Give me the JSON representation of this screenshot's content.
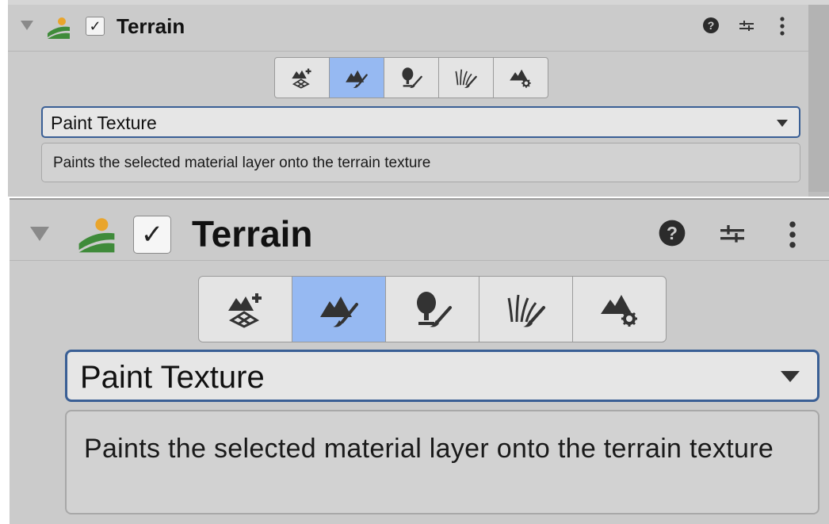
{
  "component": {
    "title": "Terrain",
    "enabled_mark": "✓"
  },
  "tools": [
    {
      "icon": "create-neighbor-terrains-icon",
      "active": false
    },
    {
      "icon": "paint-terrain-icon",
      "active": true
    },
    {
      "icon": "paint-trees-icon",
      "active": false
    },
    {
      "icon": "paint-details-icon",
      "active": false
    },
    {
      "icon": "terrain-settings-icon",
      "active": false
    }
  ],
  "mode_dropdown": {
    "selected": "Paint Texture"
  },
  "description": {
    "text": "Paints the selected material layer onto the terrain texture"
  },
  "colors": {
    "active_tool": "#96b9f2",
    "dropdown_border": "#3a5f95",
    "panel_bg": "#cbcbcb",
    "terrain_green": "#3f8b3a",
    "terrain_sun": "#e9a52c"
  }
}
